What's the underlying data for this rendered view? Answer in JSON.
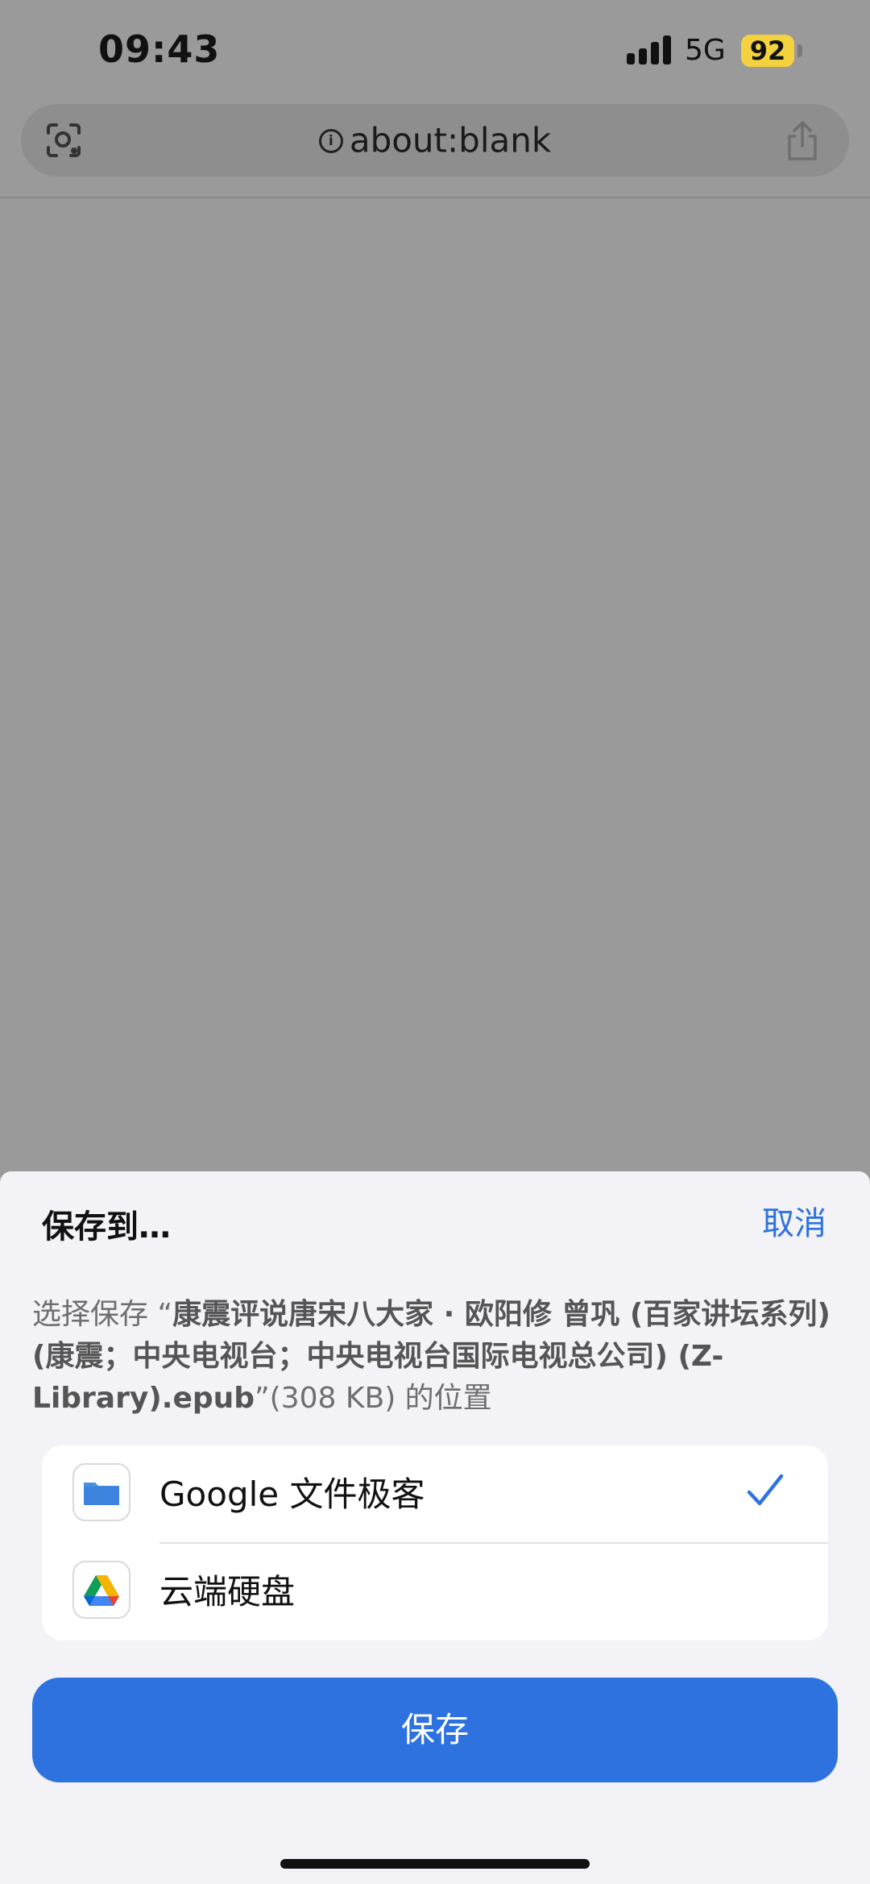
{
  "status_bar": {
    "time": "09:43",
    "network": "5G",
    "battery": "92",
    "battery_color": "#f4d23e"
  },
  "browser": {
    "url": "about:blank",
    "icons": {
      "left": "visual-search-icon",
      "info": "info-icon",
      "right": "share-icon"
    }
  },
  "sheet": {
    "title": "保存到…",
    "cancel_label": "取消",
    "description": {
      "prefix": "选择保存 “",
      "filename": "康震评说唐宋八大家 · 欧阳修 曾巩 (百家讲坛系列) (康震；中央电视台；中央电视台国际电视总公司) (Z-Library).epub",
      "suffix": "”(308 KB) 的位置"
    },
    "destinations": [
      {
        "label": "Google 文件极客",
        "icon": "folder-icon",
        "selected": true
      },
      {
        "label": "云端硬盘",
        "icon": "google-drive-icon",
        "selected": false
      }
    ],
    "save_label": "保存",
    "accent_color": "#2e72e0"
  }
}
